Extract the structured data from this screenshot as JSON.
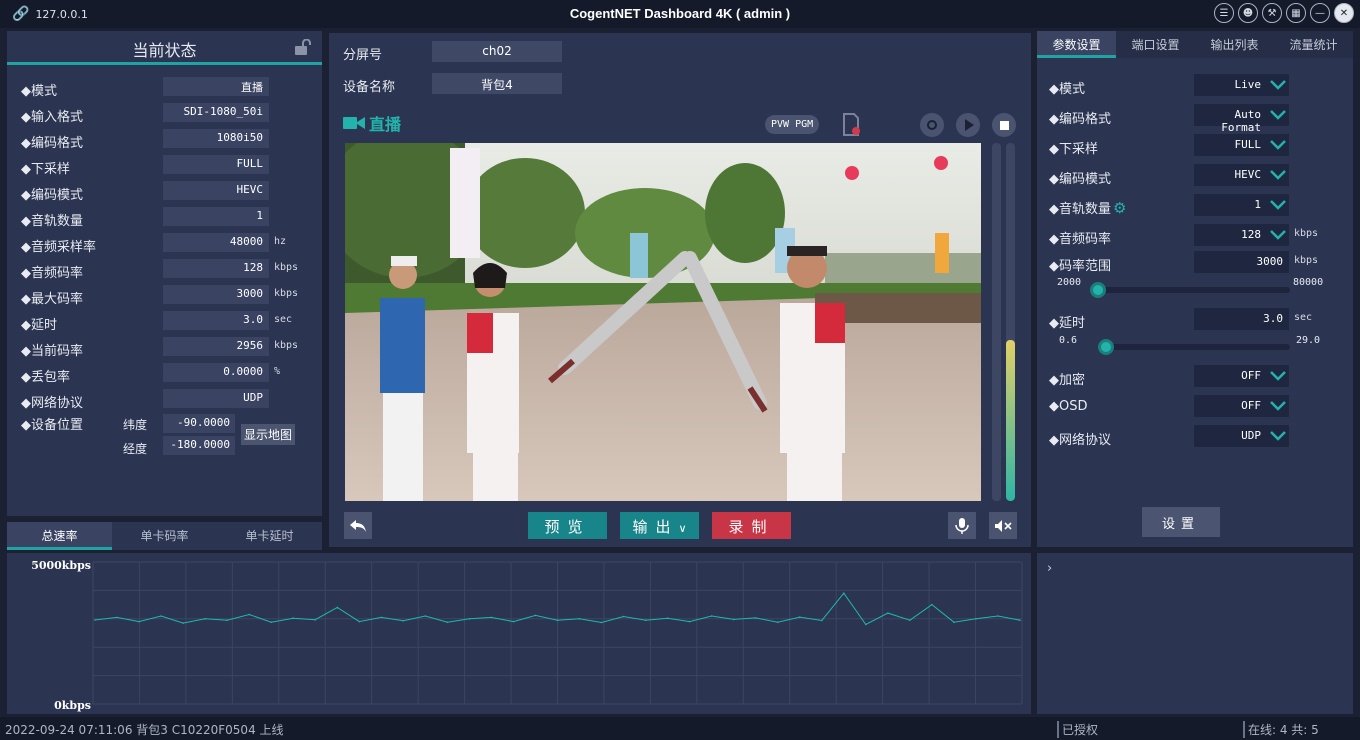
{
  "titlebar": {
    "host": "127.0.0.1",
    "title": "CogentNET Dashboard 4K ( admin )"
  },
  "status_panel": {
    "title": "当前状态",
    "rows": [
      {
        "label": "◆模式",
        "value": "直播",
        "unit": ""
      },
      {
        "label": "◆输入格式",
        "value": "SDI-1080_50i",
        "unit": ""
      },
      {
        "label": "◆编码格式",
        "value": "1080i50",
        "unit": ""
      },
      {
        "label": "◆下采样",
        "value": "FULL",
        "unit": ""
      },
      {
        "label": "◆编码模式",
        "value": "HEVC",
        "unit": ""
      },
      {
        "label": "◆音轨数量",
        "value": "1",
        "unit": ""
      },
      {
        "label": "◆音频采样率",
        "value": "48000",
        "unit": "hz"
      },
      {
        "label": "◆音频码率",
        "value": "128",
        "unit": "kbps"
      },
      {
        "label": "◆最大码率",
        "value": "3000",
        "unit": "kbps"
      },
      {
        "label": "◆延时",
        "value": "3.0",
        "unit": "sec"
      },
      {
        "label": "◆当前码率",
        "value": "2956",
        "unit": "kbps"
      },
      {
        "label": "◆丢包率",
        "value": "0.0000",
        "unit": "%"
      },
      {
        "label": "◆网络协议",
        "value": "UDP",
        "unit": ""
      }
    ],
    "location": {
      "label": "◆设备位置",
      "lat_label": "纬度",
      "lat_value": "-90.0000",
      "lon_label": "经度",
      "lon_value": "-180.0000",
      "map_button": "显示地图"
    }
  },
  "bottom_tabs": [
    "总速率",
    "单卡码率",
    "单卡延时"
  ],
  "center": {
    "screen_label": "分屏号",
    "screen_value": "ch02",
    "device_label": "设备名称",
    "device_value": "背包4",
    "live_label": "直播",
    "pvw_pgm": "PVW PGM",
    "preview_button": "预览",
    "output_button": "输出",
    "record_button": "录制",
    "audio_level": 0.45
  },
  "settings": {
    "tabs": [
      "参数设置",
      "端口设置",
      "输出列表",
      "流量统计"
    ],
    "rows": [
      {
        "label": "◆模式",
        "value": "Live"
      },
      {
        "label": "◆编码格式",
        "value": "Auto Format"
      },
      {
        "label": "◆下采样",
        "value": "FULL"
      },
      {
        "label": "◆编码模式",
        "value": "HEVC"
      },
      {
        "label": "◆音轨数量",
        "value": "1"
      },
      {
        "label": "◆音频码率",
        "value": "128",
        "unit": "kbps"
      }
    ],
    "bitrate_range": {
      "label": "◆码率范围",
      "value": "3000",
      "unit": "kbps",
      "min": "2000",
      "max": "80000",
      "current": 2000
    },
    "delay": {
      "label": "◆延时",
      "value": "3.0",
      "unit": "sec",
      "min": "0.6",
      "max": "29.0",
      "current": 0.6
    },
    "rows2": [
      {
        "label": "◆加密",
        "value": "OFF"
      },
      {
        "label": "◆OSD",
        "value": "OFF"
      },
      {
        "label": "◆网络协议",
        "value": "UDP"
      }
    ],
    "apply_button": "设置"
  },
  "chart_data": {
    "type": "line",
    "title": "",
    "ylabel": "",
    "ylim": [
      0,
      5000
    ],
    "y_tick_labels": [
      "5000kbps",
      "0kbps"
    ],
    "grid": true,
    "series": [
      {
        "values": [
          2956,
          3050,
          2900,
          3100,
          2850,
          3000,
          2950,
          3150,
          2880,
          3020,
          2970,
          3400,
          2900,
          3050,
          2930,
          3100,
          2880,
          3000,
          3050,
          2900,
          3120,
          2950,
          3000,
          2870,
          3080,
          2950,
          3020,
          2900,
          3100,
          2980,
          3030,
          2880,
          3060,
          2940,
          3900,
          2800,
          3200,
          2950,
          3500,
          2880,
          3000,
          3100,
          2950
        ]
      }
    ],
    "line_color": "#1fb8b0"
  },
  "statusbar": {
    "message": "2022-09-24 07:11:06 背包3 C10220F0504 上线",
    "auth": "已授权",
    "online": "在线: 4 共: 5"
  }
}
